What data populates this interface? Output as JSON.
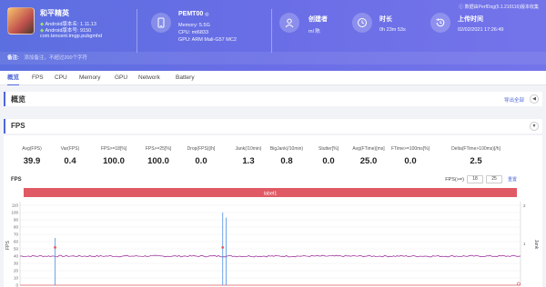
{
  "header": {
    "top_note": "ⓘ 数据由PerfDog(5.1.210116)版本收集",
    "app": {
      "name": "和平精英",
      "android_label": "Android版本名: 1.11.13",
      "android_code": "Android版本号: 9150",
      "package": "com.tencent.tmgp.pubgmhd"
    },
    "device": {
      "name": "PEMT00",
      "memory": "Memory: 5.5G",
      "cpu": "CPU: mt6833",
      "gpu": "GPU: ARM Mali-G57 MC2"
    },
    "creator": {
      "label": "创建者",
      "value": "ml 陈"
    },
    "duration": {
      "label": "时长",
      "value": "0h 23m 53s"
    },
    "upload": {
      "label": "上传时间",
      "value": "02/02/2021 17:26:49"
    },
    "note": {
      "label": "备注:",
      "value": "添加备注，不超过200个字符"
    }
  },
  "tabs": [
    "概览",
    "FPS",
    "CPU",
    "Memory",
    "GPU",
    "Network",
    "Battery"
  ],
  "overview": {
    "title": "概览",
    "export": "导出全部"
  },
  "fps_section": {
    "title": "FPS"
  },
  "stats": [
    {
      "label": "Avg(FPS)",
      "value": "39.9"
    },
    {
      "label": "Var(FPS)",
      "value": "0.4"
    },
    {
      "label": "FPS>=18[%]",
      "value": "100.0"
    },
    {
      "label": "FPS>=25[%]",
      "value": "100.0"
    },
    {
      "label": "Drop(FPS)[/h]",
      "value": "0.0"
    },
    {
      "label": "Jank(/10min)",
      "value": "1.3"
    },
    {
      "label": "BigJank(/10min)",
      "value": "0.8"
    },
    {
      "label": "Stutter[%]",
      "value": "0.0"
    },
    {
      "label": "Avg(FTime)[ms]",
      "value": "25.0"
    },
    {
      "label": "FTime>=100ms[%]",
      "value": "0.0"
    },
    {
      "label": "Delta(FTime>100ms)[/h]",
      "value": "2.5"
    }
  ],
  "chart_controls": {
    "title": "FPS",
    "fps_ge_label": "FPS(>=)",
    "box1": "18",
    "box2": "25",
    "reset": "重置"
  },
  "colors": {
    "accent": "#4f66d8",
    "fps_line": "#a23ca0",
    "spike": "#4a90e2",
    "label_bar": "#e05a66"
  },
  "chart_data": {
    "type": "line",
    "label_bar": "label1",
    "ylabel_left": "FPS",
    "ylabel_right": "Jank",
    "yticks_left": [
      "110",
      "100",
      "90",
      "80",
      "70",
      "60",
      "50",
      "40",
      "30",
      "20",
      "10",
      "0"
    ],
    "yticks_right": [
      "2",
      "1"
    ],
    "ylim": [
      0,
      110
    ],
    "series": [
      {
        "name": "FPS",
        "approx_value": 40,
        "spikes": [
          {
            "x_frac": 0.07,
            "y": 65
          },
          {
            "x_frac": 0.405,
            "y": 100
          },
          {
            "x_frac": 0.412,
            "y": 93
          }
        ]
      }
    ]
  }
}
